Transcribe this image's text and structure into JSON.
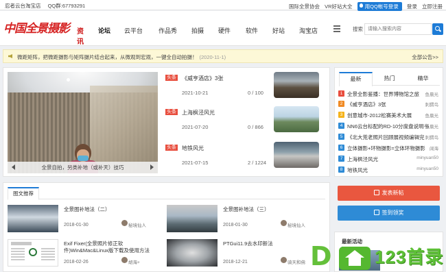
{
  "topbar": {
    "shop": "忍者云台淘宝店",
    "qq_group": "QQ群:67793291",
    "links": [
      "国际全景协会",
      "VR好站大全"
    ],
    "qq_login": "用QQ帐号登录",
    "login": "登录",
    "register": "立即注册"
  },
  "header": {
    "logo_text": "中国全景摄影",
    "logo_badge": "资讯",
    "nav": [
      "论坛",
      "云平台",
      "作品秀",
      "拍摄",
      "硬件",
      "软件",
      "好站",
      "淘宝店"
    ],
    "active_nav": "论坛",
    "search_label": "搜索",
    "search_placeholder": "请输入搜索内容"
  },
  "notice": {
    "text": "微距矩阵，把微距摄影与矩阵摄片结合起来，从微观到宏观，一键全自动拍摄！",
    "date": "(2020-11-1)",
    "more": "全部公告>>"
  },
  "slider": {
    "caption": "全景自拍，另类补地（或补天）技巧"
  },
  "news": [
    {
      "tag": "头条",
      "title": "《威亨酒店》3张",
      "date": "2021-10-21",
      "views": "0 / 100"
    },
    {
      "tag": "头条",
      "title": "上海枫泾风光",
      "date": "2021-07-20",
      "views": "0 / 866"
    },
    {
      "tag": "头条",
      "title": "地铁风光",
      "date": "2021-07-15",
      "views": "2 / 1224"
    }
  ],
  "side_tabs": [
    "最新",
    "热门",
    "精华"
  ],
  "ranking": [
    {
      "num": "1",
      "title": "全景全影鉴播：世界博物馆之旅",
      "author": "鱼晨光",
      "color": "#e84d3d"
    },
    {
      "num": "2",
      "title": "《威亨酒店》3张",
      "author": "刺猬鸟",
      "color": "#f08a24"
    },
    {
      "num": "3",
      "title": "创意城市-2012松赛美术大展",
      "author": "鱼晨光",
      "color": "#f5b31b"
    },
    {
      "num": "4",
      "title": "NN6云台标配的RD-10分度盘说明书",
      "author": "鱼晨光",
      "color": "#2e8bd6"
    },
    {
      "num": "5",
      "title": "《北大荒老照片回顾展视频编辑完",
      "author": "刺猬鸟",
      "color": "#2e8bd6"
    },
    {
      "num": "6",
      "title": "立体摄影+环物摄影=立体环物摄影",
      "author": "阔海",
      "color": "#2e8bd6"
    },
    {
      "num": "7",
      "title": "上海枫泾风光",
      "author": "minyuan50",
      "color": "#2e8bd6"
    },
    {
      "num": "8",
      "title": "地铁风光",
      "author": "minyuan50",
      "color": "#2e8bd6"
    }
  ],
  "grid": {
    "title": "图文推荐",
    "items": [
      {
        "title": "全景图补地法（二）",
        "date": "2018-01-30",
        "author": "秘境仙人"
      },
      {
        "title": "全景图补地法（三）",
        "date": "2018-01-30",
        "author": "秘境仙人"
      },
      {
        "title": "Exif Fixer(全景照片修正软件)Win&Mac&Linux版下载及使用方法",
        "date": "2018-02-26",
        "author": "胡海+"
      },
      {
        "title": "PTGui11.9去水印新法",
        "date": "2018-12-21",
        "author": "骑天和佛"
      }
    ]
  },
  "actions": {
    "post": "发表新帖",
    "sign": "签到领奖"
  },
  "activity": {
    "title": "最新活动"
  },
  "watermark": {
    "letter": "D",
    "brand": "123首录"
  }
}
